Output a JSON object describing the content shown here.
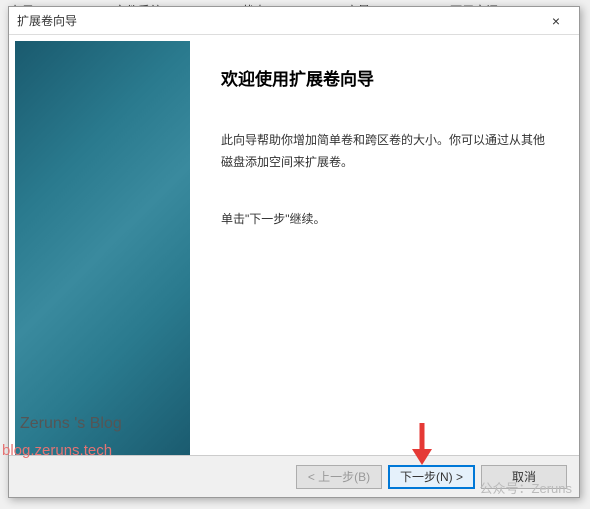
{
  "background": {
    "col1": "布局",
    "col2": "文件系统",
    "col3": "状态",
    "col4": "容量",
    "col5": "可用空间"
  },
  "dialog": {
    "title": "扩展卷向导",
    "close_label": "×"
  },
  "wizard": {
    "heading": "欢迎使用扩展卷向导",
    "paragraph1": "此向导帮助你增加简单卷和跨区卷的大小。你可以通过从其他磁盘添加空间来扩展卷。",
    "paragraph2": "单击\"下一步\"继续。"
  },
  "buttons": {
    "back": "< 上一步(B)",
    "next": "下一步(N) >",
    "cancel": "取消"
  },
  "watermarks": {
    "blog": "Zeruns 's Blog",
    "url": "blog.zeruns.tech",
    "wechat": "公众号：Zeruns"
  }
}
